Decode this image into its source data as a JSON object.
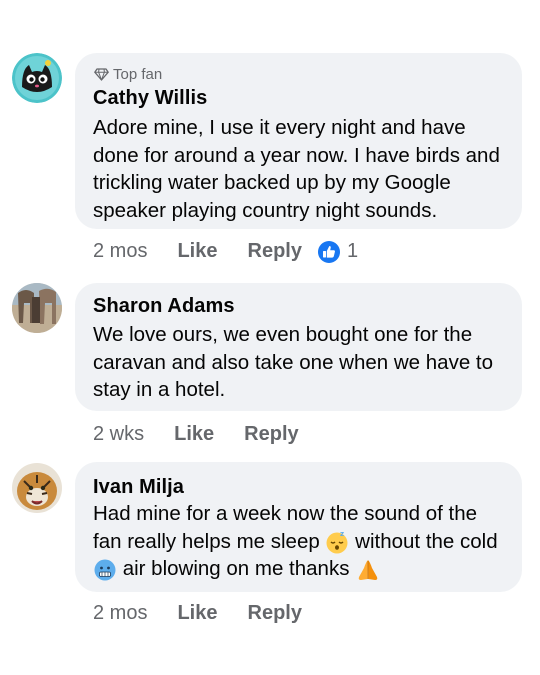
{
  "comments": [
    {
      "badge": "Top fan",
      "badge_icon": "diamond-icon",
      "name": "Cathy Willis",
      "text": "Adore mine, I use it every night and have done for around a year now. I have birds and trickling water backed up by my Google speaker playing country night sounds.",
      "time": "2 mos",
      "like_label": "Like",
      "reply_label": "Reply",
      "reaction_icon": "thumbs-up-icon",
      "reaction_count": "1"
    },
    {
      "name": "Sharon Adams",
      "text": "We love ours, we even bought one for the caravan and also take one when we have to stay in a hotel.",
      "time": "2 wks",
      "like_label": "Like",
      "reply_label": "Reply"
    },
    {
      "name": "Ivan Milja",
      "text_parts": [
        "Had mine for a week now the sound of the fan really helps me sleep ",
        " without the cold ",
        " air blowing on me thanks "
      ],
      "emojis": [
        "sleeping-face-icon",
        "cold-face-icon",
        "folded-hands-icon"
      ],
      "time": "2 mos",
      "like_label": "Like",
      "reply_label": "Reply"
    }
  ],
  "colors": {
    "bubble": "#f0f2f5",
    "meta_text": "#65676b",
    "reaction_blue": "#1877f2"
  }
}
